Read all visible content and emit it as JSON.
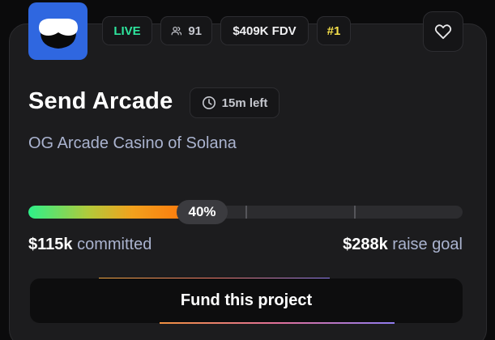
{
  "project": {
    "name": "Send Arcade",
    "tagline": "OG Arcade Casino of Solana",
    "logo_icon": "visor-face-icon"
  },
  "badges": {
    "live": "LIVE",
    "participants": "91",
    "participants_icon": "users-icon",
    "fdv": "$409K FDV",
    "rank": "#1"
  },
  "time_left": {
    "label": "15m left",
    "icon": "clock-icon"
  },
  "favorite": {
    "icon": "heart-icon"
  },
  "progress": {
    "percent_label": "40%",
    "fraction": 0.4,
    "milestones": [
      0.5,
      0.75
    ]
  },
  "funding": {
    "committed_amount": "$115k",
    "committed_label": "committed",
    "goal_amount": "$288k",
    "goal_label": "raise goal"
  },
  "cta": {
    "label": "Fund this project"
  },
  "colors": {
    "live_green": "#2ee59d",
    "rank_yellow": "#f5e04a",
    "logo_blue": "#2f67e0",
    "card_bg": "#1c1c1e"
  }
}
